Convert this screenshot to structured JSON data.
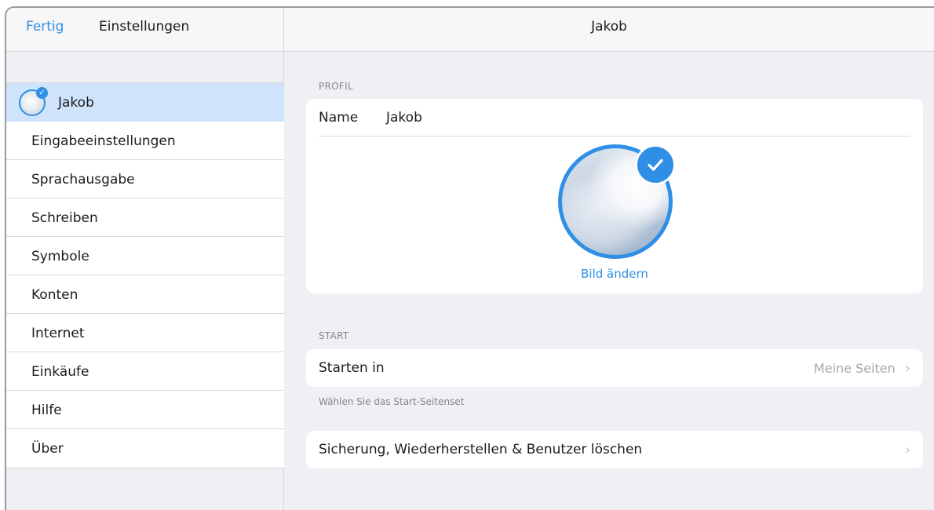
{
  "sidebar": {
    "done_label": "Fertig",
    "title": "Einstellungen",
    "items": [
      {
        "label": "Jakob"
      },
      {
        "label": "Eingabeeinstellungen"
      },
      {
        "label": "Sprachausgabe"
      },
      {
        "label": "Schreiben"
      },
      {
        "label": "Symbole"
      },
      {
        "label": "Konten"
      },
      {
        "label": "Internet"
      },
      {
        "label": "Einkäufe"
      },
      {
        "label": "Hilfe"
      },
      {
        "label": "Über"
      }
    ]
  },
  "main": {
    "title": "Jakob",
    "profile": {
      "section_label": "PROFIL",
      "name_label": "Name",
      "name_value": "Jakob",
      "change_picture": "Bild ändern"
    },
    "start": {
      "section_label": "START",
      "row_label": "Starten in",
      "row_value": "Meine Seiten",
      "hint": "Wählen Sie das Start-Seitenset"
    },
    "backup": {
      "row_label": "Sicherung, Wiederherstellen & Benutzer löschen"
    }
  },
  "colors": {
    "accent": "#2f8fe6",
    "selected_bg": "#cfe3fa",
    "grouped_bg": "#efeff4"
  },
  "icons": {
    "check": "checkmark-badge-icon",
    "chevron": "chevron-right-icon"
  }
}
